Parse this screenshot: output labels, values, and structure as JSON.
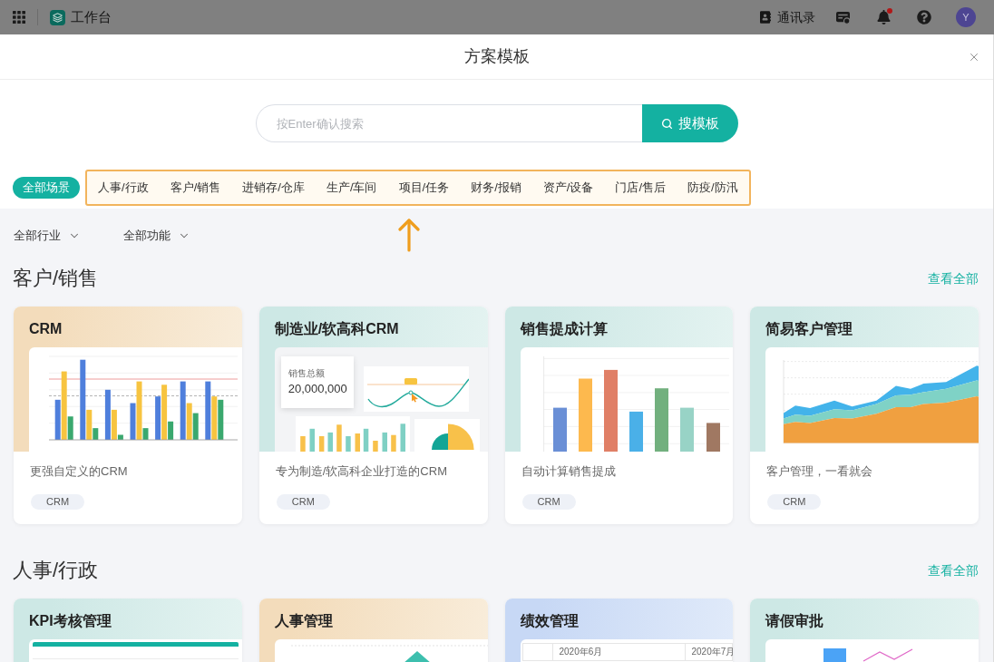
{
  "app_bar": {
    "title": "工作台",
    "contacts_label": "通讯录",
    "notifications": {
      "unread": true
    },
    "avatar": "Y"
  },
  "dialog": {
    "title": "方案模板"
  },
  "search": {
    "placeholder": "按Enter确认搜索",
    "button": "搜模板"
  },
  "category_groups": [
    {
      "highlighted": false,
      "tabs": [
        {
          "label": "全部场景",
          "selected": true
        }
      ]
    },
    {
      "highlighted": true,
      "tabs": [
        {
          "label": "人事/行政",
          "selected": false
        },
        {
          "label": "客户/销售",
          "selected": false
        },
        {
          "label": "进销存/仓库",
          "selected": false
        },
        {
          "label": "生产/车间",
          "selected": false
        },
        {
          "label": "项目/任务",
          "selected": false
        },
        {
          "label": "财务/报销",
          "selected": false
        },
        {
          "label": "资产/设备",
          "selected": false
        },
        {
          "label": "门店/售后",
          "selected": false
        },
        {
          "label": "防疫/防汛",
          "selected": false
        }
      ]
    }
  ],
  "filters": [
    "全部行业",
    "全部功能"
  ],
  "sections": [
    {
      "title": "客户/销售",
      "link": "查看全部",
      "cards": [
        {
          "title": "CRM",
          "color": "#f3dcbb",
          "preview": {
            "kind": "grouped-bars"
          },
          "description": "更强自定义的CRM",
          "tag": "CRM"
        },
        {
          "title": "制造业/软高科CRM",
          "color": "#cde8e5",
          "preview": {
            "kind": "dashboard",
            "label": "销售总额",
            "value": "20,000,000"
          },
          "description": "专为制造/软高科企业打造的CRM",
          "tag": "CRM"
        },
        {
          "title": "销售提成计算",
          "color": "#cde8e5",
          "preview": {
            "kind": "bars"
          },
          "description": "自动计算销售提成",
          "tag": "CRM"
        },
        {
          "title": "简易客户管理",
          "color": "#cde8e5",
          "preview": {
            "kind": "stacked-area"
          },
          "description": "客户管理，一看就会",
          "tag": "CRM"
        }
      ]
    },
    {
      "title": "人事/行政",
      "link": "查看全部",
      "cards": [
        {
          "title": "KPI考核管理",
          "color": "#cde8e5",
          "preview": {
            "kind": "table-header"
          }
        },
        {
          "title": "人事管理",
          "color": "#f3dcbb",
          "preview": {
            "kind": "peak-line"
          }
        },
        {
          "title": "绩效管理",
          "color": "#c7d8f5",
          "preview": {
            "kind": "month-table",
            "columns": [
              "2020年6月",
              "2020年7月"
            ]
          }
        },
        {
          "title": "请假审批",
          "color": "#cde8e5",
          "preview": {
            "kind": "bar-line"
          }
        }
      ]
    }
  ]
}
